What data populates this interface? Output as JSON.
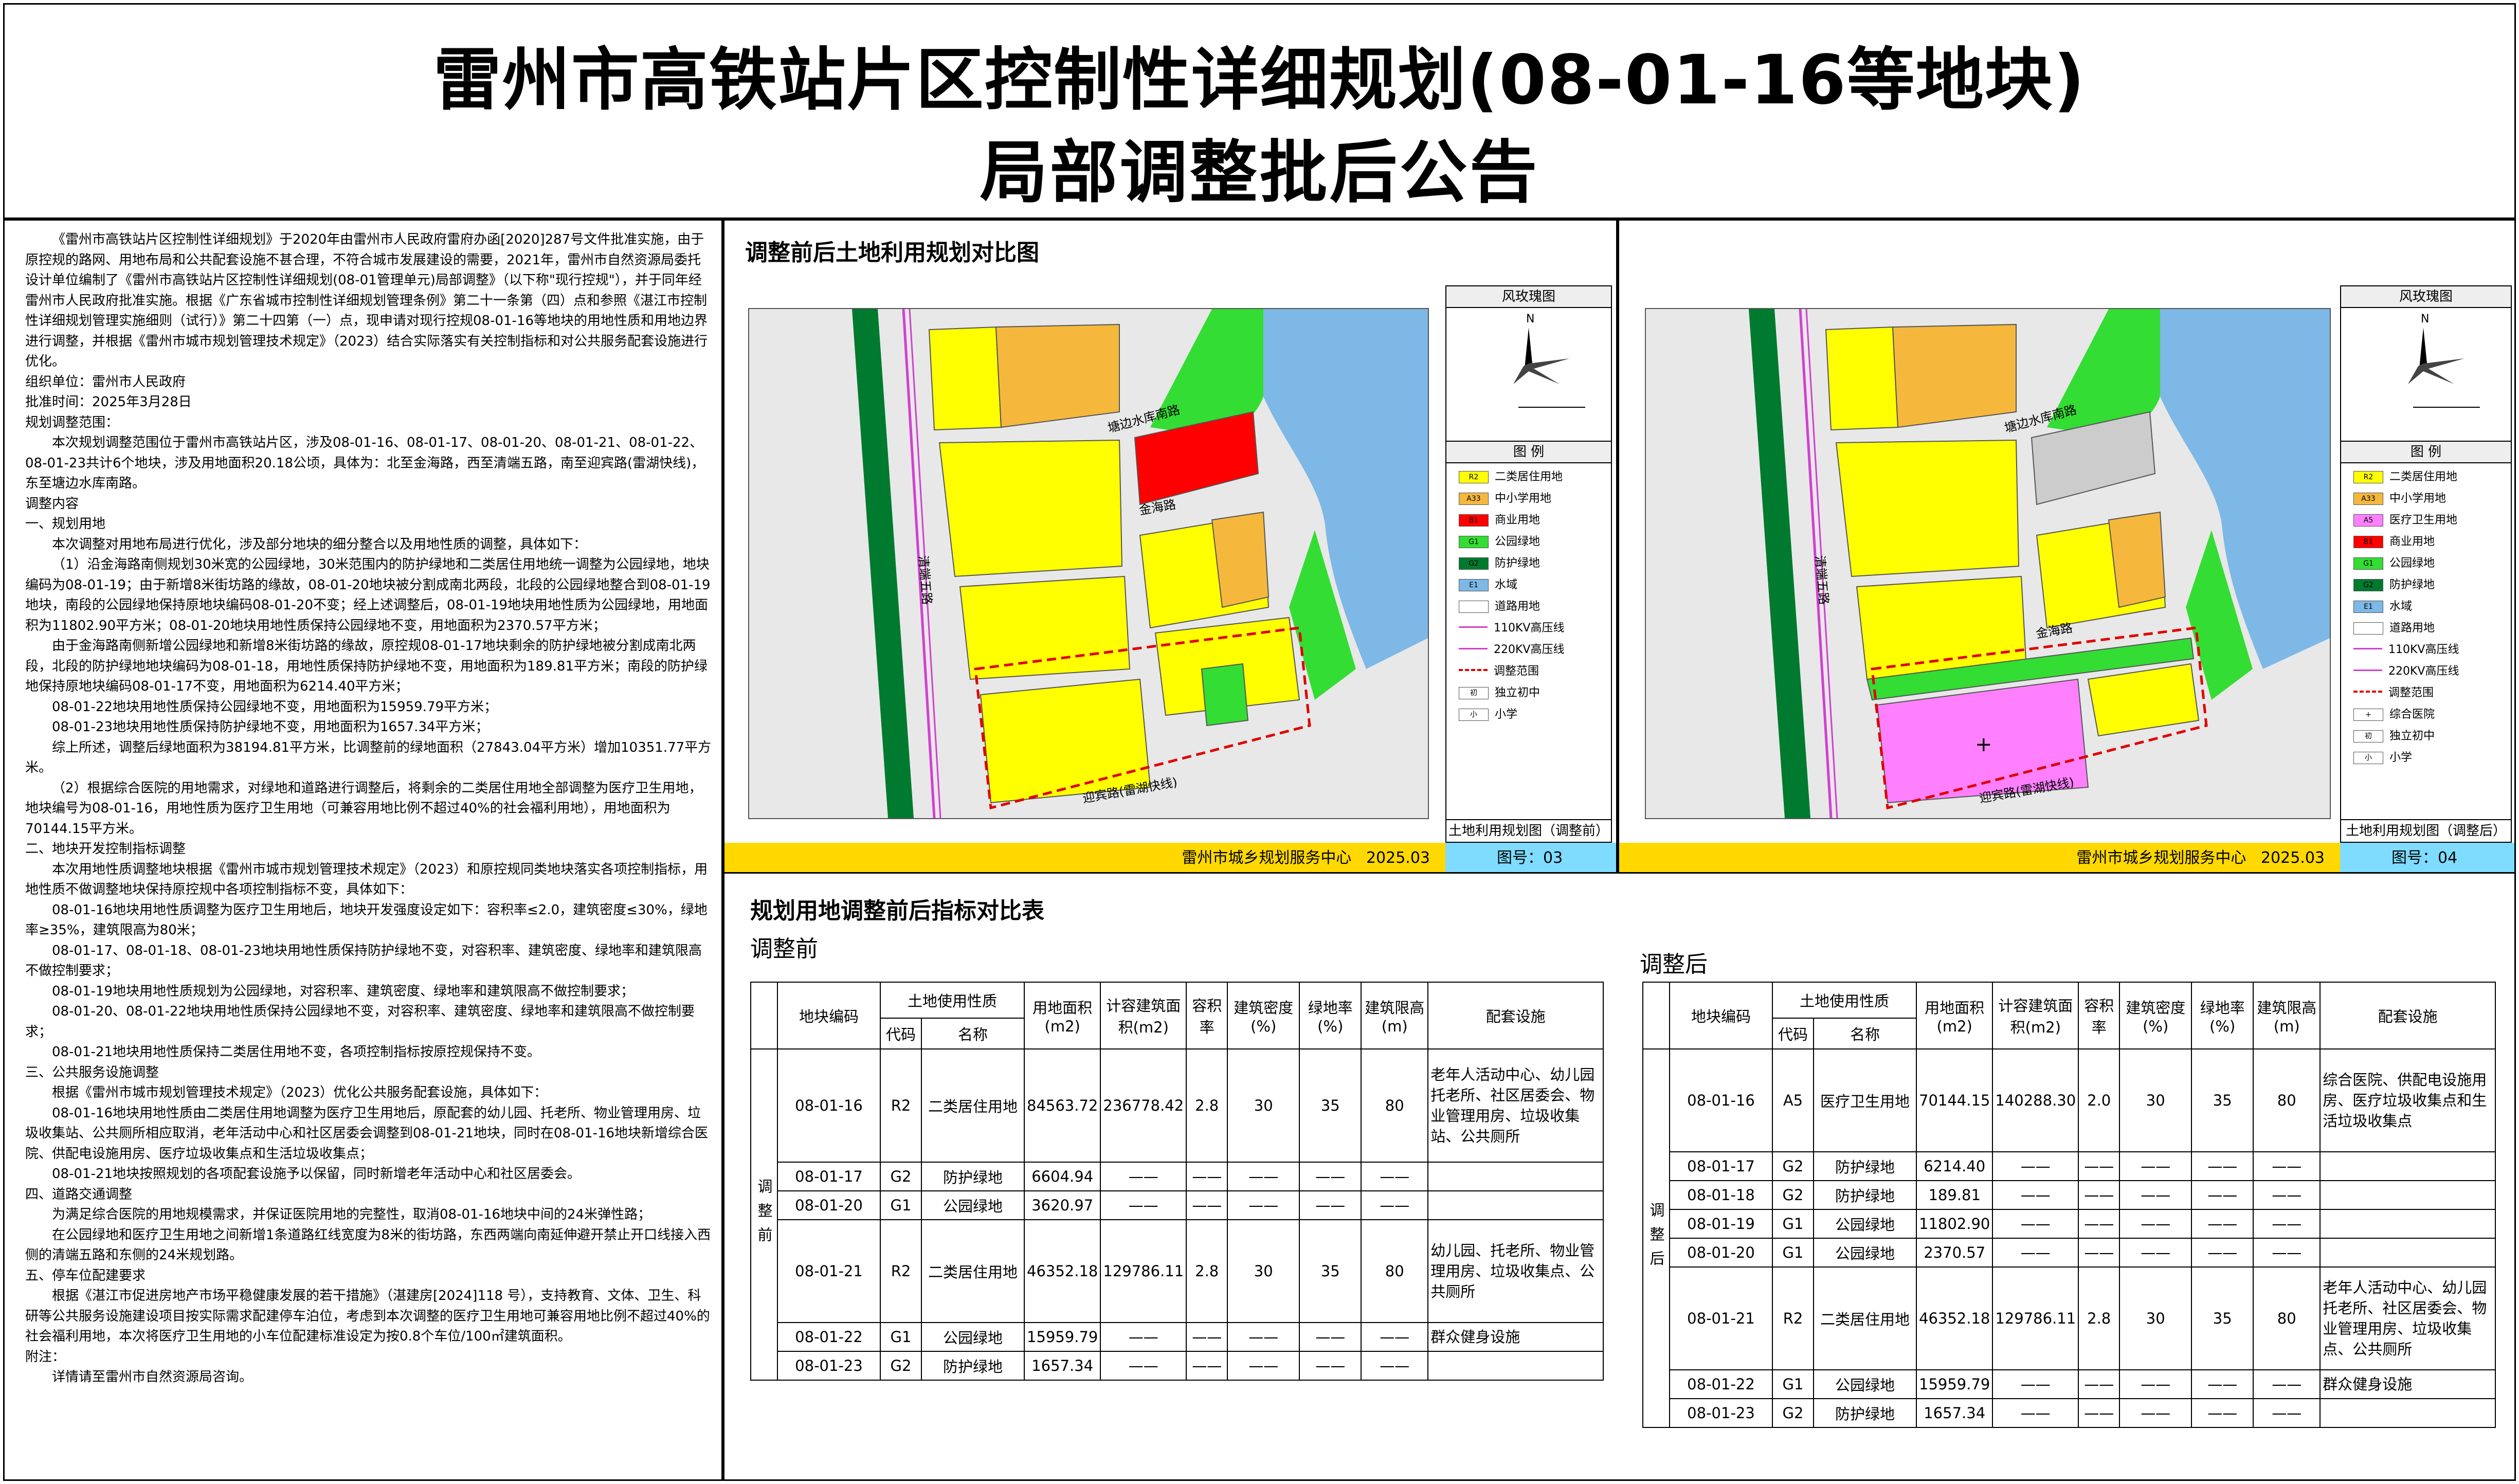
{
  "title": {
    "line1": "雷州市高铁站片区控制性详细规划(08-01-16等地块)",
    "line2": "局部调整批后公告"
  },
  "text": {
    "p1": "《雷州市高铁站片区控制性详细规划》于2020年由雷州市人民政府雷府办函[2020]287号文件批准实施，由于原控规的路网、用地布局和公共配套设施不甚合理，不符合城市发展建设的需要，2021年，雷州市自然资源局委托设计单位编制了《雷州市高铁站片区控制性详细规划(08-01管理单元)局部调整》（以下称\"现行控规\"），并于同年经雷州市人民政府批准实施。根据《广东省城市控制性详细规划管理条例》第二十一条第（四）点和参照《湛江市控制性详细规划管理实施细则（试行）》第二十四第（一）点，现申请对现行控规08-01-16等地块的用地性质和用地边界进行调整，并根据《雷州市城市规划管理技术规定》（2023）结合实际落实有关控制指标和对公共服务配套设施进行优化。",
    "p2": "组织单位：雷州市人民政府",
    "p3": "批准时间：2025年3月28日",
    "p4": "规划调整范围：",
    "p5": "本次规划调整范围位于雷州市高铁站片区，涉及08-01-16、08-01-17、08-01-20、08-01-21、08-01-22、08-01-23共计6个地块，涉及用地面积20.18公顷，具体为：北至金海路，西至清端五路，南至迎宾路(雷湖快线)，东至塘边水库南路。",
    "p6": "调整内容",
    "p7": "一、规划用地",
    "p8": "本次调整对用地布局进行优化，涉及部分地块的细分整合以及用地性质的调整，具体如下：",
    "p9": "（1）沿金海路南侧规划30米宽的公园绿地，30米范围内的防护绿地和二类居住用地统一调整为公园绿地，地块编码为08-01-19；由于新增8米街坊路的缘故，08-01-20地块被分割成南北两段，北段的公园绿地整合到08-01-19地块，南段的公园绿地保持原地块编码08-01-20不变；经上述调整后，08-01-19地块用地性质为公园绿地，用地面积为11802.90平方米；08-01-20地块用地性质保持公园绿地不变，用地面积为2370.57平方米；",
    "p10": "由于金海路南侧新增公园绿地和新增8米街坊路的缘故，原控规08-01-17地块剩余的防护绿地被分割成南北两段，北段的防护绿地地块编码为08-01-18，用地性质保持防护绿地不变，用地面积为189.81平方米；南段的防护绿地保持原地块编码08-01-17不变，用地面积为6214.40平方米；",
    "p11": "08-01-22地块用地性质保持公园绿地不变，用地面积为15959.79平方米；",
    "p12": "08-01-23地块用地性质保持防护绿地不变，用地面积为1657.34平方米；",
    "p13": "综上所述，调整后绿地面积为38194.81平方米，比调整前的绿地面积（27843.04平方米）增加10351.77平方米。",
    "p14": "（2）根据综合医院的用地需求，对绿地和道路进行调整后，将剩余的二类居住用地全部调整为医疗卫生用地，地块编号为08-01-16，用地性质为医疗卫生用地（可兼容用地比例不超过40%的社会福利用地），用地面积为70144.15平方米。",
    "p15": "二、地块开发控制指标调整",
    "p16": "本次用地性质调整地块根据《雷州市城市规划管理技术规定》（2023）和原控规同类地块落实各项控制指标，用地性质不做调整地块保持原控规中各项控制指标不变，具体如下：",
    "p17": "08-01-16地块用地性质调整为医疗卫生用地后，地块开发强度设定如下：容积率≤2.0，建筑密度≤30%，绿地率≥35%，建筑限高为80米；",
    "p18": "08-01-17、08-01-18、08-01-23地块用地性质保持防护绿地不变，对容积率、建筑密度、绿地率和建筑限高不做控制要求；",
    "p19": "08-01-19地块用地性质规划为公园绿地，对容积率、建筑密度、绿地率和建筑限高不做控制要求；",
    "p20": "08-01-20、08-01-22地块用地性质保持公园绿地不变，对容积率、建筑密度、绿地率和建筑限高不做控制要求；",
    "p21": "08-01-21地块用地性质保持二类居住用地不变，各项控制指标按原控规保持不变。",
    "p22": "三、公共服务设施调整",
    "p23": "根据《雷州市城市规划管理技术规定》（2023）优化公共服务配套设施，具体如下：",
    "p24": "08-01-16地块用地性质由二类居住用地调整为医疗卫生用地后，原配套的幼儿园、托老所、物业管理用房、垃圾收集站、公共厕所相应取消，老年活动中心和社区居委会调整到08-01-21地块，同时在08-01-16地块新增综合医院、供配电设施用房、医疗垃圾收集点和生活垃圾收集点；",
    "p25": "08-01-21地块按照规划的各项配套设施予以保留，同时新增老年活动中心和社区居委会。",
    "p26": "四、道路交通调整",
    "p27": "为满足综合医院的用地规模需求，并保证医院用地的完整性，取消08-01-16地块中间的24米弹性路；",
    "p28": "在公园绿地和医疗卫生用地之间新增1条道路红线宽度为8米的街坊路，东西两端向南延伸避开禁止开口线接入西侧的清端五路和东侧的24米规划路。",
    "p29": "五、停车位配建要求",
    "p30": "根据《湛江市促进房地产市场平稳健康发展的若干措施》（湛建房[2024]118 号），支持教育、文体、卫生、科研等公共服务设施建设项目按实际需求配建停车泊位，考虑到本次调整的医疗卫生用地可兼容用地比例不超过40%的社会福利用地，本次将医疗卫生用地的小车位配建标准设定为按0.8个车位/100㎡建筑面积。",
    "p31": "附注：",
    "p32": "详情请至雷州市自然资源局咨询。"
  },
  "compare": {
    "title": "调整前后土地利用规划对比图",
    "roads": {
      "tangbian": "塘边水库南路",
      "jinhai": "金海路",
      "qingduan": "清端五路",
      "yingbin": "迎宾路(雷湖快线)"
    },
    "wind_label": "风玫瑰图",
    "north": "N",
    "legend_title": "图 例",
    "before": {
      "legend": [
        {
          "code": "R2",
          "label": "二类居住用地",
          "color": "#ffff00"
        },
        {
          "code": "A33",
          "label": "中小学用地",
          "color": "#f5b83d"
        },
        {
          "code": "B1",
          "label": "商业用地",
          "color": "#ff0000"
        },
        {
          "code": "G1",
          "label": "公园绿地",
          "color": "#33dd33"
        },
        {
          "code": "G2",
          "label": "防护绿地",
          "color": "#007a2e"
        },
        {
          "code": "E1",
          "label": "水域",
          "color": "#7eb8e6"
        },
        {
          "code": "",
          "label": "道路用地",
          "color": "#ffffff"
        },
        {
          "code": "",
          "label": "110KV高压线",
          "color": "#ffffff"
        },
        {
          "code": "",
          "label": "220KV高压线",
          "color": "#ffffff"
        },
        {
          "code": "",
          "label": "调整范围",
          "color": "#ffffff"
        },
        {
          "code": "初",
          "label": "独立初中",
          "color": "#ffffff"
        },
        {
          "code": "小",
          "label": "小学",
          "color": "#ffffff"
        }
      ],
      "map_label": "土地利用规划图（调整前）",
      "footer_org": "雷州市城乡规划服务中心",
      "footer_date": "2025.03",
      "footer_fig": "图号：03"
    },
    "after": {
      "legend": [
        {
          "code": "R2",
          "label": "二类居住用地",
          "color": "#ffff00"
        },
        {
          "code": "A33",
          "label": "中小学用地",
          "color": "#f5b83d"
        },
        {
          "code": "A5",
          "label": "医疗卫生用地",
          "color": "#ff80ff"
        },
        {
          "code": "B1",
          "label": "商业用地",
          "color": "#ff0000"
        },
        {
          "code": "G1",
          "label": "公园绿地",
          "color": "#33dd33"
        },
        {
          "code": "G2",
          "label": "防护绿地",
          "color": "#007a2e"
        },
        {
          "code": "E1",
          "label": "水域",
          "color": "#7eb8e6"
        },
        {
          "code": "",
          "label": "道路用地",
          "color": "#ffffff"
        },
        {
          "code": "",
          "label": "110KV高压线",
          "color": "#ffffff"
        },
        {
          "code": "",
          "label": "220KV高压线",
          "color": "#ffffff"
        },
        {
          "code": "",
          "label": "调整范围",
          "color": "#ffffff"
        },
        {
          "code": "+",
          "label": "综合医院",
          "color": "#ffffff"
        },
        {
          "code": "初",
          "label": "独立初中",
          "color": "#ffffff"
        },
        {
          "code": "小",
          "label": "小学",
          "color": "#ffffff"
        }
      ],
      "map_label": "土地利用规划图（调整后）",
      "footer_org": "雷州市城乡规划服务中心",
      "footer_date": "2025.03",
      "footer_fig": "图号：04"
    }
  },
  "tables": {
    "title": "规划用地调整前后指标对比表",
    "before_heading": "调整前",
    "after_heading": "调整后",
    "headers": {
      "block": "地块编码",
      "landuse": "土地使用性质",
      "code": "代码",
      "name": "名称",
      "area": "用地面积(m2)",
      "gfa": "计容建筑面积(m2)",
      "far": "容积率",
      "density": "建筑密度(%)",
      "green": "绿地率(%)",
      "height": "建筑限高(m)",
      "facilities": "配套设施"
    },
    "before_label": "调整前",
    "after_label": "调整后",
    "before_rows": [
      {
        "block": "08-01-16",
        "code": "R2",
        "name": "二类居住用地",
        "area": "84563.72",
        "gfa": "236778.42",
        "far": "2.8",
        "density": "30",
        "green": "35",
        "height": "80",
        "facilities": "老年人活动中心、幼儿园托老所、社区居委会、物业管理用房、垃圾收集站、公共厕所"
      },
      {
        "block": "08-01-17",
        "code": "G2",
        "name": "防护绿地",
        "area": "6604.94",
        "gfa": "——",
        "far": "——",
        "density": "——",
        "green": "——",
        "height": "——",
        "facilities": ""
      },
      {
        "block": "08-01-20",
        "code": "G1",
        "name": "公园绿地",
        "area": "3620.97",
        "gfa": "——",
        "far": "——",
        "density": "——",
        "green": "——",
        "height": "——",
        "facilities": ""
      },
      {
        "block": "08-01-21",
        "code": "R2",
        "name": "二类居住用地",
        "area": "46352.18",
        "gfa": "129786.11",
        "far": "2.8",
        "density": "30",
        "green": "35",
        "height": "80",
        "facilities": "幼儿园、托老所、物业管理用房、垃圾收集点、公共厕所"
      },
      {
        "block": "08-01-22",
        "code": "G1",
        "name": "公园绿地",
        "area": "15959.79",
        "gfa": "——",
        "far": "——",
        "density": "——",
        "green": "——",
        "height": "——",
        "facilities": "群众健身设施"
      },
      {
        "block": "08-01-23",
        "code": "G2",
        "name": "防护绿地",
        "area": "1657.34",
        "gfa": "——",
        "far": "——",
        "density": "——",
        "green": "——",
        "height": "——",
        "facilities": ""
      }
    ],
    "after_rows": [
      {
        "block": "08-01-16",
        "code": "A5",
        "name": "医疗卫生用地",
        "area": "70144.15",
        "gfa": "140288.30",
        "far": "2.0",
        "density": "30",
        "green": "35",
        "height": "80",
        "facilities": "综合医院、供配电设施用房、医疗垃圾收集点和生活垃圾收集点"
      },
      {
        "block": "08-01-17",
        "code": "G2",
        "name": "防护绿地",
        "area": "6214.40",
        "gfa": "——",
        "far": "——",
        "density": "——",
        "green": "——",
        "height": "——",
        "facilities": ""
      },
      {
        "block": "08-01-18",
        "code": "G2",
        "name": "防护绿地",
        "area": "189.81",
        "gfa": "——",
        "far": "——",
        "density": "——",
        "green": "——",
        "height": "——",
        "facilities": ""
      },
      {
        "block": "08-01-19",
        "code": "G1",
        "name": "公园绿地",
        "area": "11802.90",
        "gfa": "——",
        "far": "——",
        "density": "——",
        "green": "——",
        "height": "——",
        "facilities": ""
      },
      {
        "block": "08-01-20",
        "code": "G1",
        "name": "公园绿地",
        "area": "2370.57",
        "gfa": "——",
        "far": "——",
        "density": "——",
        "green": "——",
        "height": "——",
        "facilities": ""
      },
      {
        "block": "08-01-21",
        "code": "R2",
        "name": "二类居住用地",
        "area": "46352.18",
        "gfa": "129786.11",
        "far": "2.8",
        "density": "30",
        "green": "35",
        "height": "80",
        "facilities": "老年人活动中心、幼儿园托老所、社区居委会、物业管理用房、垃圾收集点、公共厕所"
      },
      {
        "block": "08-01-22",
        "code": "G1",
        "name": "公园绿地",
        "area": "15959.79",
        "gfa": "——",
        "far": "——",
        "density": "——",
        "green": "——",
        "height": "——",
        "facilities": "群众健身设施"
      },
      {
        "block": "08-01-23",
        "code": "G2",
        "name": "防护绿地",
        "area": "1657.34",
        "gfa": "——",
        "far": "——",
        "density": "——",
        "green": "——",
        "height": "——",
        "facilities": ""
      }
    ]
  }
}
